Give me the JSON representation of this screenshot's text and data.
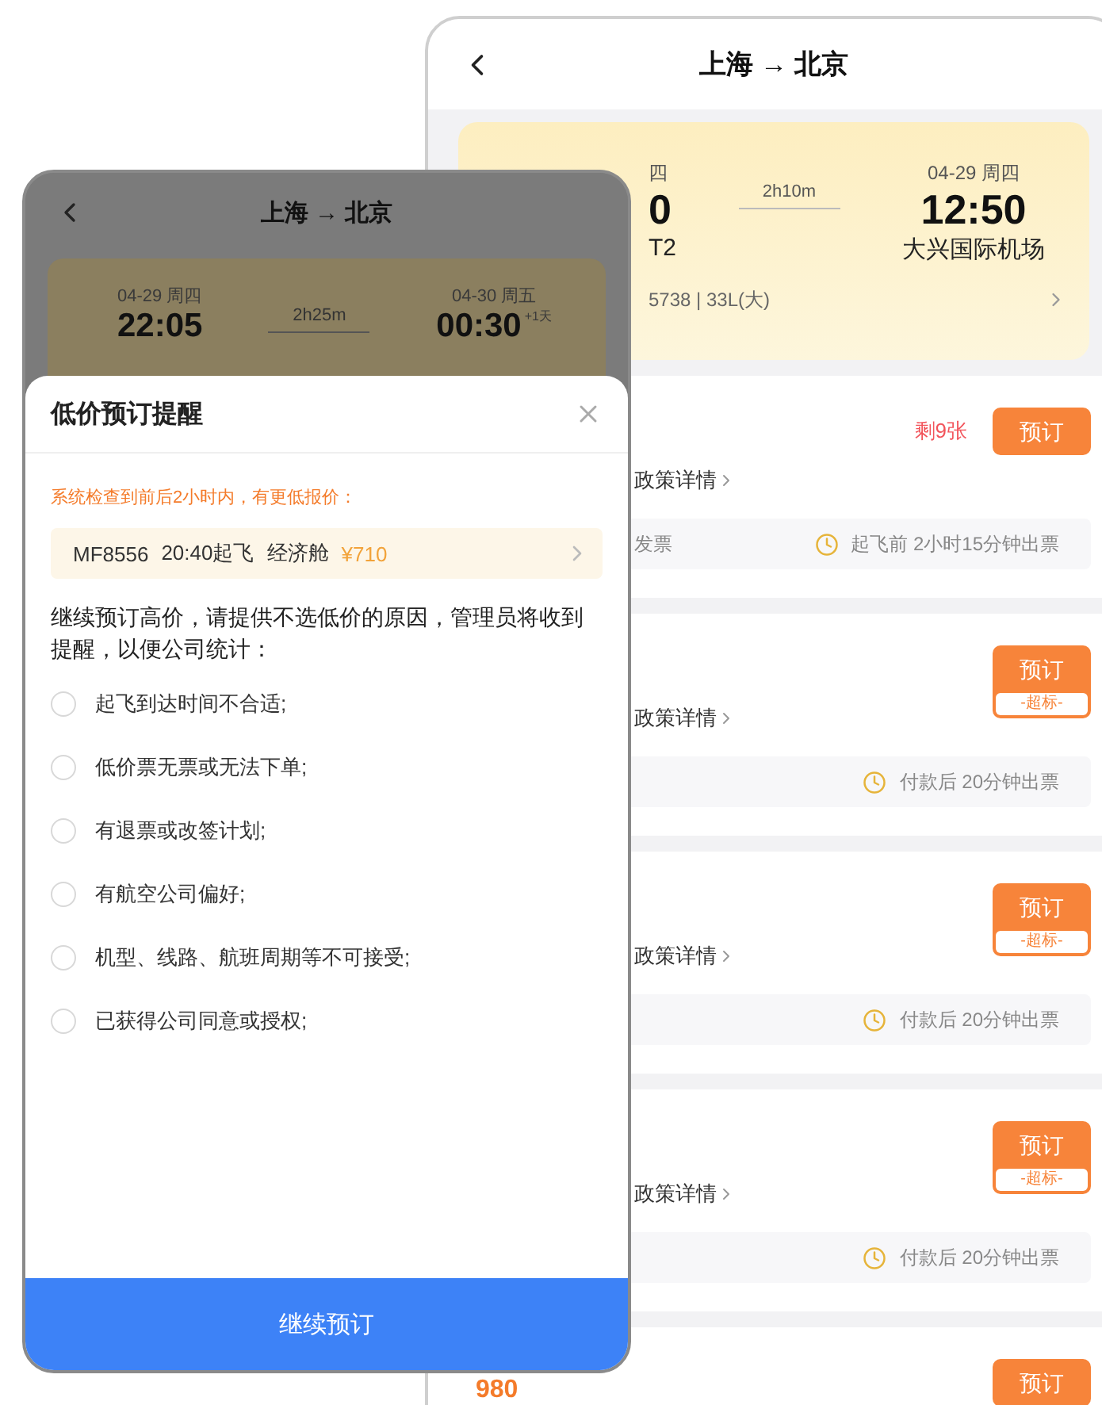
{
  "back_screen": {
    "title": "上海 → 北京",
    "flight": {
      "dep_date_fragment": "四",
      "dep_time_fragment": "0",
      "dep_airport_fragment": "T2",
      "duration": "2h10m",
      "arr_date": "04-29 周四",
      "arr_time": "12:50",
      "arr_airport": "大兴国际机场",
      "info_fragment": "5738 | 33L(大)"
    },
    "fares": [
      {
        "remaining": "剩9张",
        "book": "预订",
        "policy": "政策详情",
        "note": "发票",
        "ticketing": "起飞前 2小时15分钟出票"
      },
      {
        "book": "预订",
        "tag": "-超标-",
        "policy": "政策详情",
        "ticketing": "付款后 20分钟出票"
      },
      {
        "book": "预订",
        "tag": "-超标-",
        "policy": "政策详情",
        "ticketing": "付款后 20分钟出票"
      },
      {
        "book": "预订",
        "tag": "-超标-",
        "policy": "政策详情",
        "ticketing": "付款后 20分钟出票"
      },
      {
        "book": "预订",
        "price": "980"
      }
    ]
  },
  "front_screen": {
    "title": "上海 → 北京",
    "flight": {
      "dep_date": "04-29 周四",
      "dep_time": "22:05",
      "duration": "2h25m",
      "arr_date": "04-30 周五",
      "arr_time": "00:30",
      "next_day": "+1天"
    },
    "dialog": {
      "title": "低价预订提醒",
      "notice": "系统检查到前后2小时内，有更低报价：",
      "lower_fare": {
        "flight": "MF8556",
        "departure": "20:40起飞",
        "cabin": "经济舱",
        "price": "¥710"
      },
      "prompt": "继续预订高价，请提供不选低价的原因，管理员将收到提醒，以便公司统计：",
      "reasons": [
        {
          "label": "起飞到达时间不合适;",
          "selected": false
        },
        {
          "label": "低价票无票或无法下单;",
          "selected": false
        },
        {
          "label": "有退票或改签计划;",
          "selected": false
        },
        {
          "label": "有航空公司偏好;",
          "selected": false
        },
        {
          "label": "机型、线路、航班周期等不可接受;",
          "selected": false
        },
        {
          "label": "已获得公司同意或授权;",
          "selected": false
        }
      ],
      "confirm": "继续预订"
    }
  }
}
